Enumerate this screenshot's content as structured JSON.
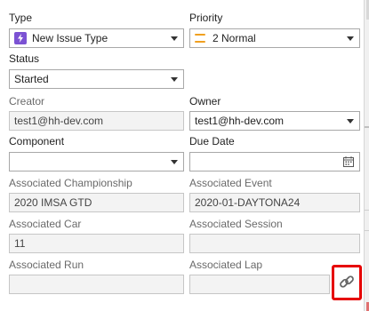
{
  "type": {
    "label": "Type",
    "value": "New Issue Type",
    "icon": "lightning-icon",
    "icon_color": "#7b52d3"
  },
  "priority": {
    "label": "Priority",
    "value": "2 Normal",
    "icon": "priority-normal-icon",
    "icon_color": "#f0a020"
  },
  "status": {
    "label": "Status",
    "value": "Started"
  },
  "creator": {
    "label": "Creator",
    "value": "test1@hh-dev.com"
  },
  "owner": {
    "label": "Owner",
    "value": "test1@hh-dev.com"
  },
  "component": {
    "label": "Component",
    "value": ""
  },
  "due_date": {
    "label": "Due Date",
    "value": "",
    "icon": "calendar-icon"
  },
  "assoc_championship": {
    "label": "Associated Championship",
    "value": "2020 IMSA GTD"
  },
  "assoc_event": {
    "label": "Associated Event",
    "value": "2020-01-DAYTONA24"
  },
  "assoc_car": {
    "label": "Associated Car",
    "value": "11"
  },
  "assoc_session": {
    "label": "Associated Session",
    "value": ""
  },
  "assoc_run": {
    "label": "Associated Run",
    "value": ""
  },
  "assoc_lap": {
    "label": "Associated Lap",
    "value": ""
  },
  "link_button": {
    "icon": "link-icon",
    "highlight_color": "#e60000"
  }
}
